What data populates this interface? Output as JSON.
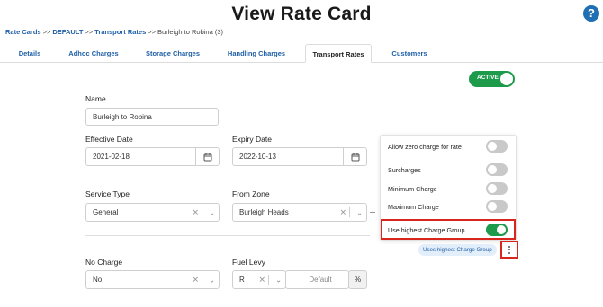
{
  "header": {
    "title": "View Rate Card",
    "help_icon": "?"
  },
  "breadcrumb": {
    "items": [
      "Rate Cards",
      "DEFAULT",
      "Transport Rates",
      "Burleigh to Robina (3)"
    ],
    "separator": ">>"
  },
  "tabs": [
    {
      "label": "Details"
    },
    {
      "label": "Adhoc Charges"
    },
    {
      "label": "Storage Charges"
    },
    {
      "label": "Handling Charges"
    },
    {
      "label": "Transport Rates",
      "active": true
    },
    {
      "label": "Customers"
    }
  ],
  "status": {
    "label": "ACTIVE",
    "on": true,
    "color": "#1e9a4b"
  },
  "form": {
    "name": {
      "label": "Name",
      "value": "Burleigh to Robina"
    },
    "effective_date": {
      "label": "Effective Date",
      "value": "2021-02-18"
    },
    "expiry_date": {
      "label": "Expiry Date",
      "value": "2022-10-13"
    },
    "service_type": {
      "label": "Service Type",
      "value": "General"
    },
    "from_zone": {
      "label": "From Zone",
      "value": "Burleigh Heads"
    },
    "no_charge": {
      "label": "No Charge",
      "value": "No"
    },
    "fuel_levy": {
      "label": "Fuel Levy",
      "unit_value": "R",
      "placeholder": "Default",
      "suffix": "%"
    }
  },
  "options_panel": {
    "items": [
      {
        "label": "Allow zero charge for rate",
        "on": false
      },
      {
        "label": "Surcharges",
        "on": false
      },
      {
        "label": "Minimum Charge",
        "on": false
      },
      {
        "label": "Maximum Charge",
        "on": false
      },
      {
        "label": "Use highest Charge Group",
        "on": true
      }
    ]
  },
  "charge_group_badge": "Uses highest Charge Group",
  "colors": {
    "link": "#1f5fa6",
    "toggle_on": "#1e9a4b",
    "toggle_off": "#c9c9c9",
    "highlight": "#d9261c",
    "badge_bg": "#e3eefb"
  }
}
